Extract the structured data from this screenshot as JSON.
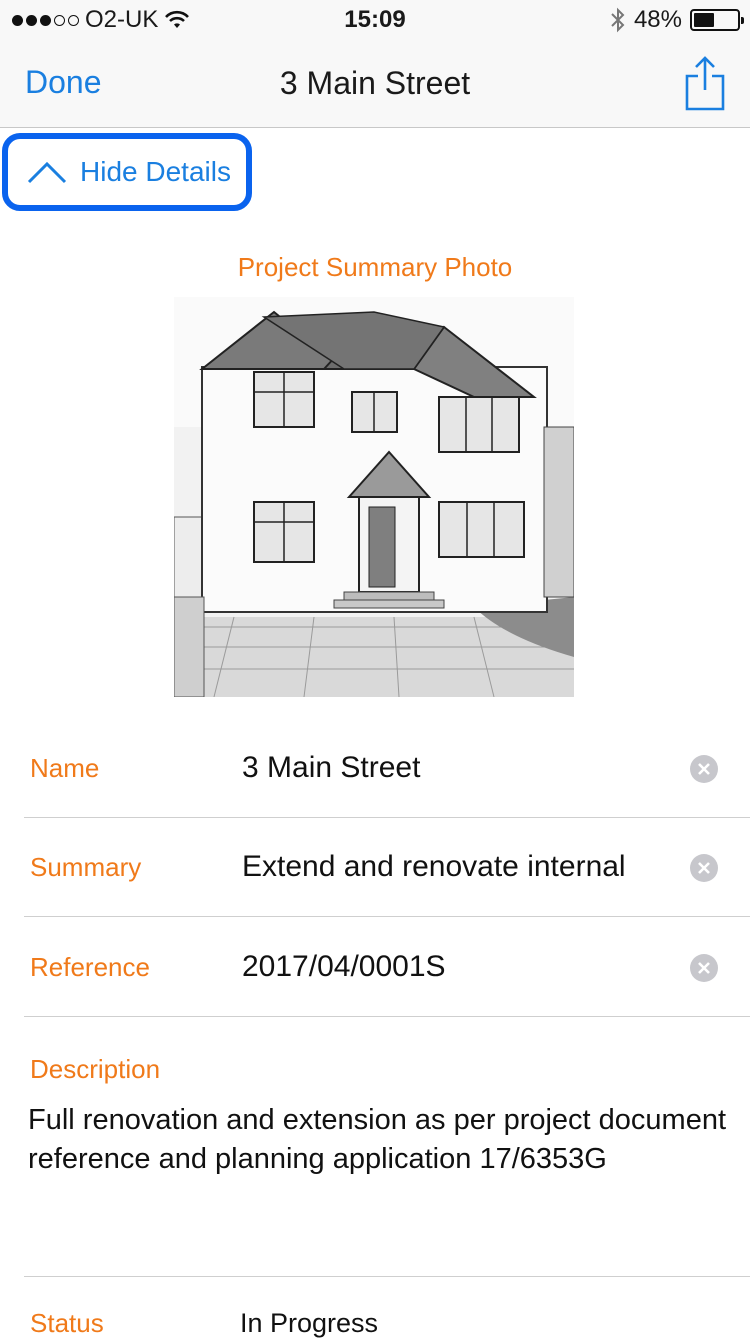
{
  "status_bar": {
    "carrier": "O2-UK",
    "time": "15:09",
    "battery": "48%",
    "battery_level": 0.48,
    "icons": [
      "signal-dots-icon",
      "wifi-icon",
      "bluetooth-icon",
      "battery-icon"
    ]
  },
  "nav": {
    "done_label": "Done",
    "title": "3 Main Street",
    "share_icon": "share-icon"
  },
  "toggle": {
    "label": "Hide Details",
    "icon": "chevron-up-icon"
  },
  "photo": {
    "label": "Project Summary Photo"
  },
  "fields": [
    {
      "label": "Name",
      "value": "3 Main Street"
    },
    {
      "label": "Summary",
      "value": "Extend and renovate internal"
    },
    {
      "label": "Reference",
      "value": "2017/04/0001S"
    }
  ],
  "description": {
    "label": "Description",
    "text": "Full renovation and extension as per project document reference and planning application 17/6353G"
  },
  "status": {
    "label": "Status",
    "value": "In Progress"
  },
  "colors": {
    "accent_blue": "#1a7fe0",
    "highlight_blue": "#0a63ee",
    "label_orange": "#f07a1a"
  }
}
